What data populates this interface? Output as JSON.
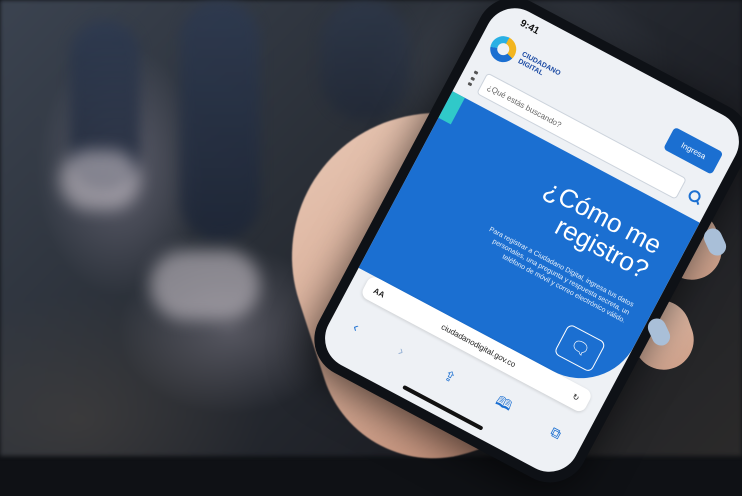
{
  "status_time": "9:41",
  "site": {
    "logo_line1": "CIUDADANO",
    "logo_line2": "DIGITAL",
    "header_button": "Ingresa"
  },
  "search": {
    "placeholder": "¿Qué estás buscando?"
  },
  "hero": {
    "title": "¿Cómo me registro?",
    "body": "Para registrar a Ciudadano Digital, ingresa tus datos personales, una pregunta y respuesta secreta, un teléfono de móvil y correo electrónico válido."
  },
  "browser": {
    "text_size_label": "AA",
    "url": "ciudadanodigital.gov.co",
    "back_icon": "chevron-left-icon",
    "forward_icon": "chevron-right-icon",
    "share_icon": "share-icon",
    "bookmarks_icon": "book-icon",
    "tabs_icon": "tabs-icon",
    "reload_icon": "reload-icon"
  },
  "colors": {
    "brand_blue": "#1b6fd1",
    "accent_teal": "#30c9c9",
    "logo_yellow": "#f2b51e"
  }
}
